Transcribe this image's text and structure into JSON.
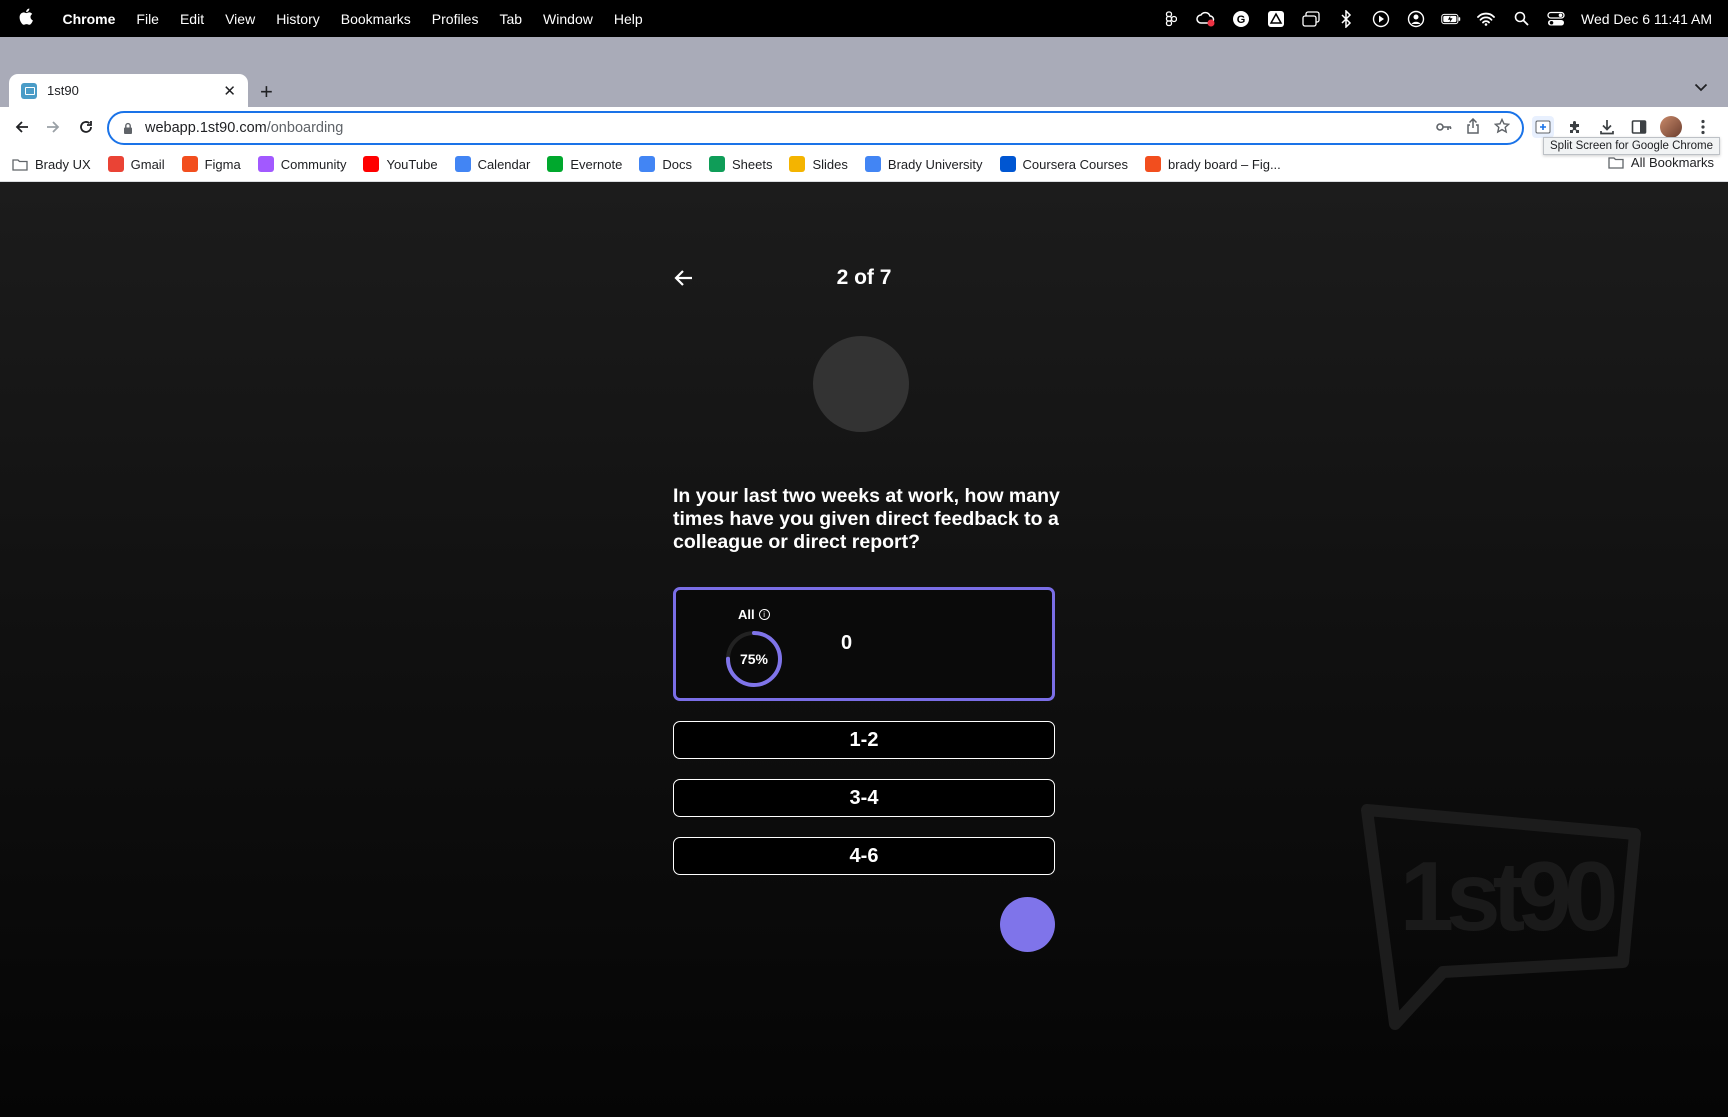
{
  "menubar": {
    "app_name": "Chrome",
    "items": [
      "File",
      "Edit",
      "View",
      "History",
      "Bookmarks",
      "Profiles",
      "Tab",
      "Window",
      "Help"
    ],
    "clock": "Wed Dec 6  11:41 AM"
  },
  "tab": {
    "title": "1st90"
  },
  "omnibox": {
    "url_host": "webapp.1st90.com",
    "url_path": "/onboarding"
  },
  "bookmarks": {
    "items": [
      {
        "label": "Brady UX",
        "icon": "folder-icon",
        "color": "#5f6368"
      },
      {
        "label": "Gmail",
        "icon": "gmail-icon",
        "color": "#ea4335"
      },
      {
        "label": "Figma",
        "icon": "figma-icon",
        "color": "#f24e1e"
      },
      {
        "label": "Community",
        "icon": "figma-icon",
        "color": "#a259ff"
      },
      {
        "label": "YouTube",
        "icon": "youtube-icon",
        "color": "#ff0000"
      },
      {
        "label": "Calendar",
        "icon": "calendar-icon",
        "color": "#4285f4"
      },
      {
        "label": "Evernote",
        "icon": "evernote-icon",
        "color": "#00a82d"
      },
      {
        "label": "Docs",
        "icon": "docs-icon",
        "color": "#4285f4"
      },
      {
        "label": "Sheets",
        "icon": "sheets-icon",
        "color": "#0f9d58"
      },
      {
        "label": "Slides",
        "icon": "slides-icon",
        "color": "#f4b400"
      },
      {
        "label": "Brady University",
        "icon": "docs-icon",
        "color": "#4285f4"
      },
      {
        "label": "Coursera Courses",
        "icon": "coursera-icon",
        "color": "#0056d2"
      },
      {
        "label": "brady board – Fig...",
        "icon": "figma-icon",
        "color": "#f24e1e"
      }
    ],
    "all_label": "All Bookmarks"
  },
  "tooltip": "Split Screen for Google Chrome",
  "onboarding": {
    "progress_label": "2 of 7",
    "question": "In your last two weeks at work, how many times have you given direct feedback to a colleague or direct report?",
    "selected_option": {
      "stat_label": "All",
      "stat_percent": "75%",
      "stat_fraction": 0.75,
      "value": "0"
    },
    "options": [
      "1-2",
      "3-4",
      "4-6"
    ],
    "accent_color": "#7f74ea"
  },
  "watermark_text": "1st90"
}
